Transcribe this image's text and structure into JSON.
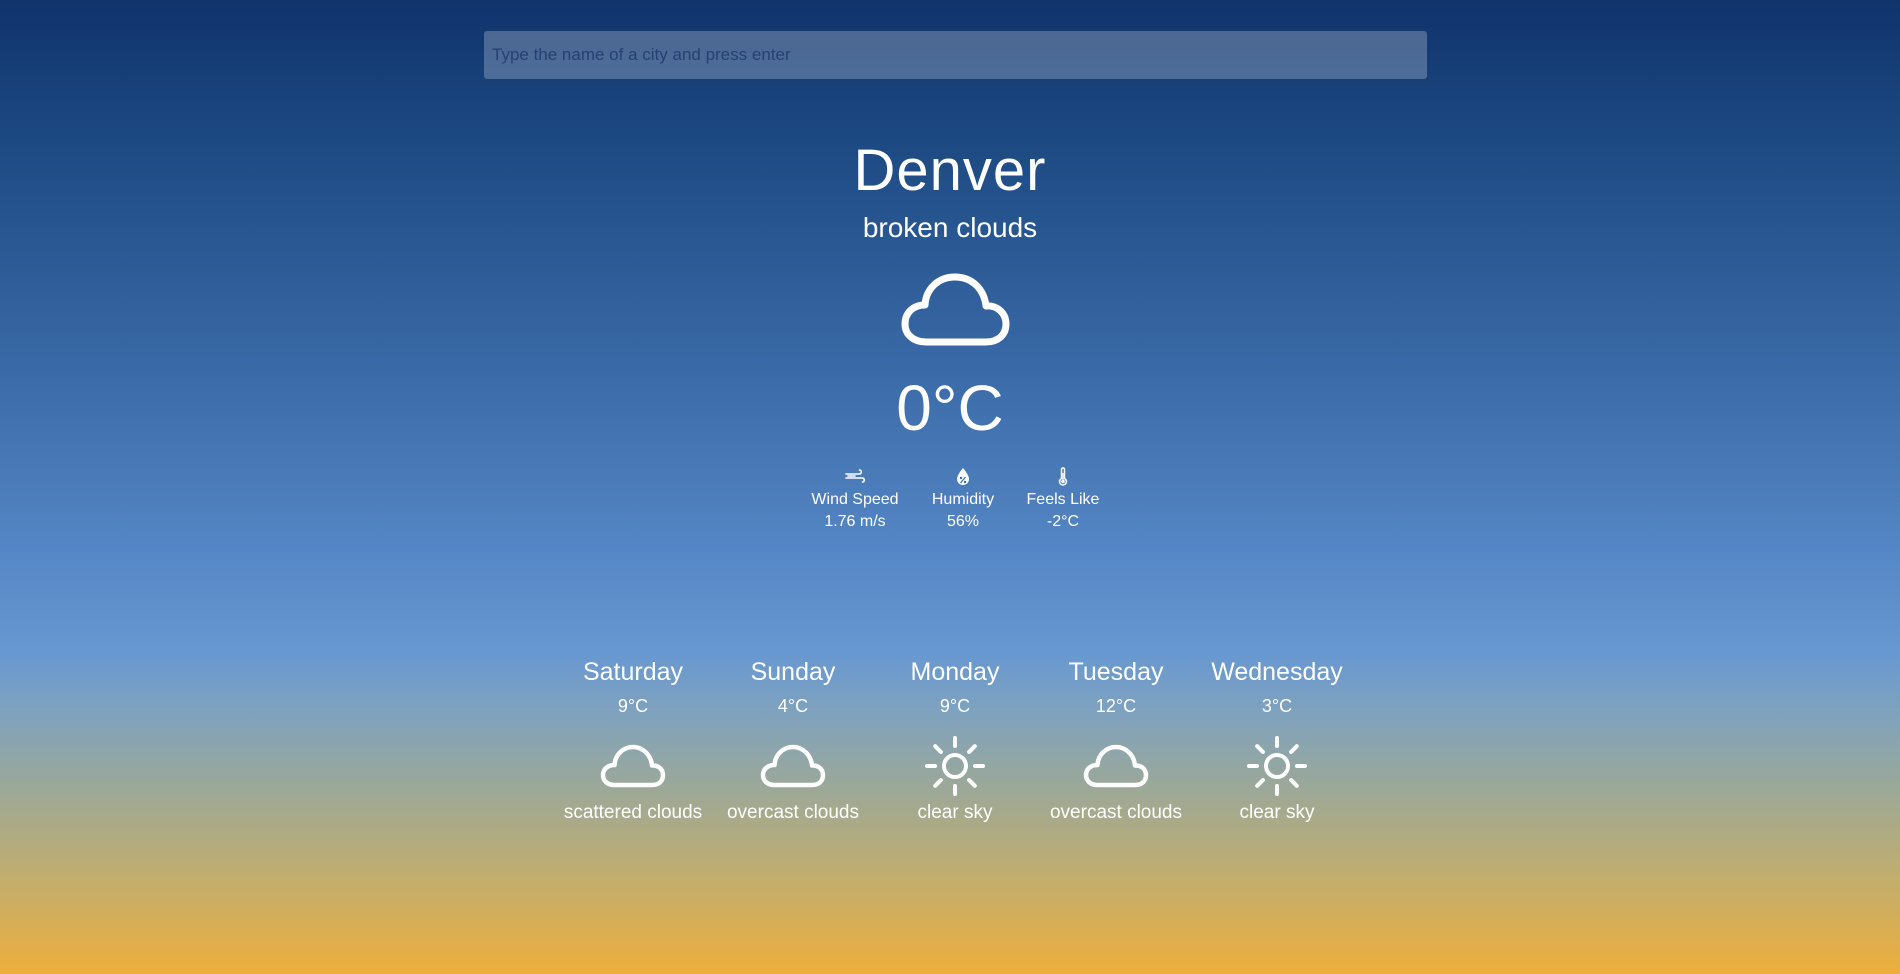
{
  "search": {
    "placeholder": "Type the name of a city and press enter",
    "value": ""
  },
  "current": {
    "city": "Denver",
    "description": "broken clouds",
    "icon": "cloud-icon",
    "temperature": "0°C"
  },
  "details": [
    {
      "icon": "wind-icon",
      "label": "Wind Speed",
      "value": "1.76 m/s"
    },
    {
      "icon": "humidity-icon",
      "label": "Humidity",
      "value": "56%"
    },
    {
      "icon": "thermometer-icon",
      "label": "Feels Like",
      "value": "-2°C"
    }
  ],
  "forecast": [
    {
      "day": "Saturday",
      "temp": "9°C",
      "icon": "cloud-icon",
      "desc": "scattered clouds"
    },
    {
      "day": "Sunday",
      "temp": "4°C",
      "icon": "cloud-icon",
      "desc": "overcast clouds"
    },
    {
      "day": "Monday",
      "temp": "9°C",
      "icon": "sun-icon",
      "desc": "clear sky"
    },
    {
      "day": "Tuesday",
      "temp": "12°C",
      "icon": "cloud-icon",
      "desc": "overcast clouds"
    },
    {
      "day": "Wednesday",
      "temp": "3°C",
      "icon": "sun-icon",
      "desc": "clear sky"
    }
  ],
  "colors": {
    "sky_top": "#10336c",
    "sky_mid": "#6898d1",
    "sky_bottom": "#eeae3c",
    "text": "#ffffff"
  }
}
